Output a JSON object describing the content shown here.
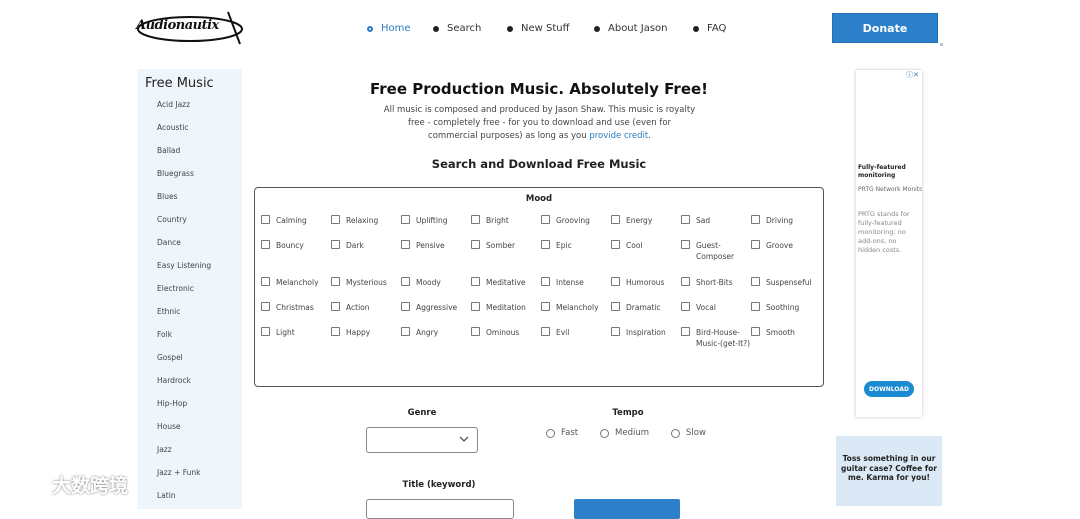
{
  "header": {
    "logo_text": "Audionautix",
    "nav": [
      {
        "label": "Home",
        "active": true
      },
      {
        "label": "Search",
        "active": false
      },
      {
        "label": "New Stuff",
        "active": false
      },
      {
        "label": "About Jason",
        "active": false
      },
      {
        "label": "FAQ",
        "active": false
      }
    ],
    "donate_label": "Donate"
  },
  "sidebar": {
    "title": "Free Music",
    "items": [
      "Acid Jazz",
      "Acoustic",
      "Ballad",
      "Bluegrass",
      "Blues",
      "Country",
      "Dance",
      "Easy Listening",
      "Electronic",
      "Ethnic",
      "Folk",
      "Gospel",
      "Hardrock",
      "Hip-Hop",
      "House",
      "Jazz",
      "Jazz + Funk",
      "Latin"
    ]
  },
  "main": {
    "title": "Free Production Music. Absolutely Free!",
    "intro_text": "All music is composed and produced by Jason Shaw. This music is royalty free - completely free - for you to download and use (even for commercial purposes) as long as you",
    "intro_link": "provide credit",
    "intro_end": ".",
    "search_title": "Search and Download Free Music",
    "mood_title": "Mood",
    "moods": [
      "Calming",
      "Relaxing",
      "Uplifting",
      "Bright",
      "Grooving",
      "Energy",
      "Sad",
      "Driving",
      "Bouncy",
      "Dark",
      "Pensive",
      "Somber",
      "Epic",
      "Cool",
      "Guest-Composer",
      "Groove",
      "Melancholy",
      "Mysterious",
      "Moody",
      "Meditative",
      "Intense",
      "Humorous",
      "Short-Bits",
      "Suspenseful",
      "Christmas",
      "Action",
      "Aggressive",
      "Meditation",
      "Melancholy",
      "Dramatic",
      "Vocal",
      "Soothing",
      "Light",
      "Happy",
      "Angry",
      "Ominous",
      "Evil",
      "Inspiration",
      "Bird-House-Music-(get-It?)",
      "Smooth"
    ],
    "genre_label": "Genre",
    "genre_value": "",
    "tempo_label": "Tempo",
    "tempo_options": [
      "Fast",
      "Medium",
      "Slow"
    ],
    "title_label": "Title (keyword)"
  },
  "ad": {
    "adchoice": "ⓘ✕",
    "headline": "Fully-featured monitoring",
    "company": "PRTG Network Monitor",
    "body": "PRTG stands for fully-featured monitoring; no add-ons, no hidden costs.",
    "button": "DOWNLOAD"
  },
  "toss": {
    "text": "Toss something in our guitar case? Coffee for me. Karma for you!"
  },
  "watermark": {
    "text": "大数跨境"
  },
  "colors": {
    "accent": "#2c80c9",
    "sidebar_bg": "#eef5fb"
  }
}
